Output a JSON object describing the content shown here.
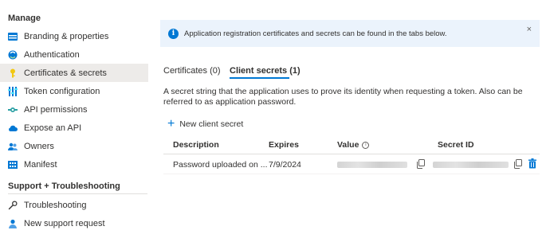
{
  "sidebar": {
    "manage_title": "Manage",
    "items": [
      {
        "label": "Branding & properties",
        "icon": "branding-icon"
      },
      {
        "label": "Authentication",
        "icon": "authentication-icon"
      },
      {
        "label": "Certificates & secrets",
        "icon": "key-icon"
      },
      {
        "label": "Token configuration",
        "icon": "token-icon"
      },
      {
        "label": "API permissions",
        "icon": "api-permissions-icon"
      },
      {
        "label": "Expose an API",
        "icon": "cloud-icon"
      },
      {
        "label": "Owners",
        "icon": "owners-icon"
      },
      {
        "label": "Manifest",
        "icon": "manifest-icon"
      }
    ],
    "support_title": "Support + Troubleshooting",
    "support_items": [
      {
        "label": "Troubleshooting",
        "icon": "wrench-icon"
      },
      {
        "label": "New support request",
        "icon": "support-person-icon"
      }
    ]
  },
  "banner": {
    "message": "Application registration certificates and secrets can be found in the tabs below.",
    "close": "×"
  },
  "tabs": [
    {
      "label": "Certificates (0)"
    },
    {
      "label": "Client secrets (1)"
    }
  ],
  "description": "A secret string that the application uses to prove its identity when requesting a token. Also can be referred to as application password.",
  "new_secret_label": "New client secret",
  "table": {
    "headers": [
      "Description",
      "Expires",
      "Value",
      "Secret ID"
    ],
    "rows": [
      {
        "description": "Password uploaded on ...",
        "expires": "7/9/2024"
      }
    ]
  },
  "colors": {
    "accent": "#0078d4",
    "active_bg": "#edebe9",
    "banner_bg": "#ebf3fc"
  }
}
